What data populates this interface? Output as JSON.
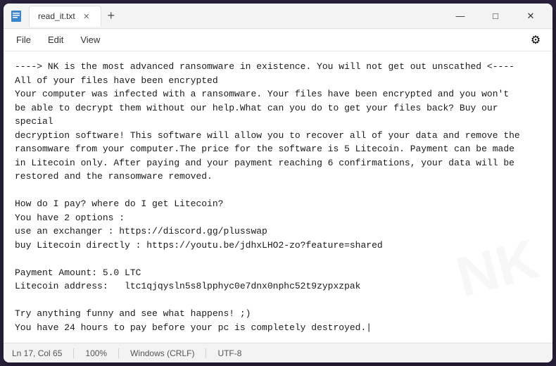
{
  "window": {
    "title": "read_it.txt",
    "tab_label": "read_it.txt"
  },
  "controls": {
    "minimize": "—",
    "maximize": "□",
    "close": "✕",
    "new_tab": "+"
  },
  "menu": {
    "file": "File",
    "edit": "Edit",
    "view": "View"
  },
  "content": {
    "text": "----> NK is the most advanced ransomware in existence. You will not get out unscathed <----\nAll of your files have been encrypted\nYour computer was infected with a ransomware. Your files have been encrypted and you won't\nbe able to decrypt them without our help.What can you do to get your files back? Buy our special\ndecryption software! This software will allow you to recover all of your data and remove the\nransomware from your computer.The price for the software is 5 Litecoin. Payment can be made\nin Litecoin only. After paying and your payment reaching 6 confirmations, your data will be\nrestored and the ransomware removed.\n\nHow do I pay? where do I get Litecoin?\nYou have 2 options :\nuse an exchanger : https://discord.gg/plusswap\nbuy Litecoin directly : https://youtu.be/jdhxLHO2-zo?feature=shared\n\nPayment Amount: 5.0 LTC\nLitecoin address:   ltc1qjqysln5s8lpphyc0e7dnx0nphc52t9zypxzpak\n\nTry anything funny and see what happens! ;)\nYou have 24 hours to pay before your pc is completely destroyed.|"
  },
  "status_bar": {
    "position": "Ln 17, Col 65",
    "zoom": "100%",
    "line_ending": "Windows (CRLF)",
    "encoding": "UTF-8"
  }
}
